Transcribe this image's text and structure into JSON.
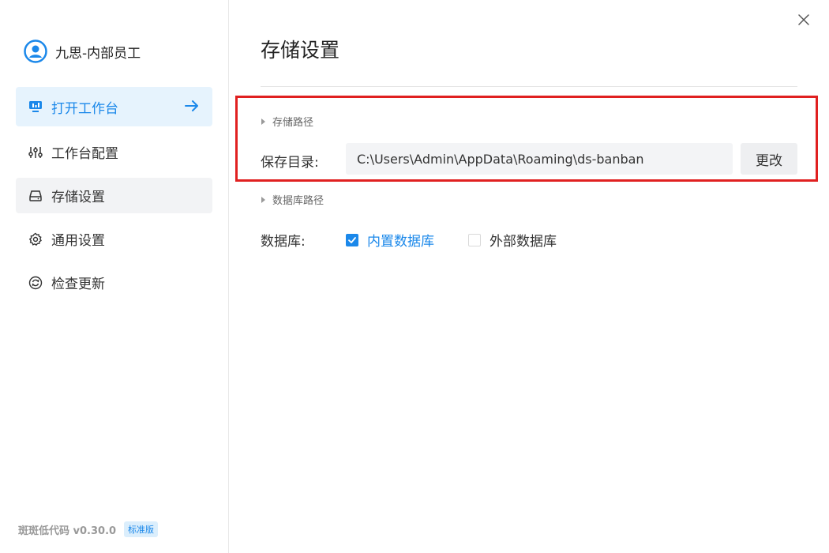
{
  "user": {
    "name": "九思-内部员工"
  },
  "nav": {
    "open_workbench": "打开工作台",
    "workbench_config": "工作台配置",
    "storage_settings": "存储设置",
    "general_settings": "通用设置",
    "check_updates": "检查更新"
  },
  "footer": {
    "version_text": "斑斑低代码 v0.30.0",
    "edition_badge": "标准版"
  },
  "main": {
    "title": "存储设置",
    "storage_path_section": "存储路径",
    "save_dir_label": "保存目录:",
    "save_dir_value": "C:\\Users\\Admin\\AppData\\Roaming\\ds-banban",
    "change_button": "更改",
    "db_path_section": "数据库路径",
    "db_label": "数据库:",
    "db_options": [
      {
        "label": "内置数据库",
        "checked": true
      },
      {
        "label": "外部数据库",
        "checked": false
      }
    ]
  },
  "colors": {
    "accent": "#1b88ea",
    "highlight_border": "#e02020"
  }
}
